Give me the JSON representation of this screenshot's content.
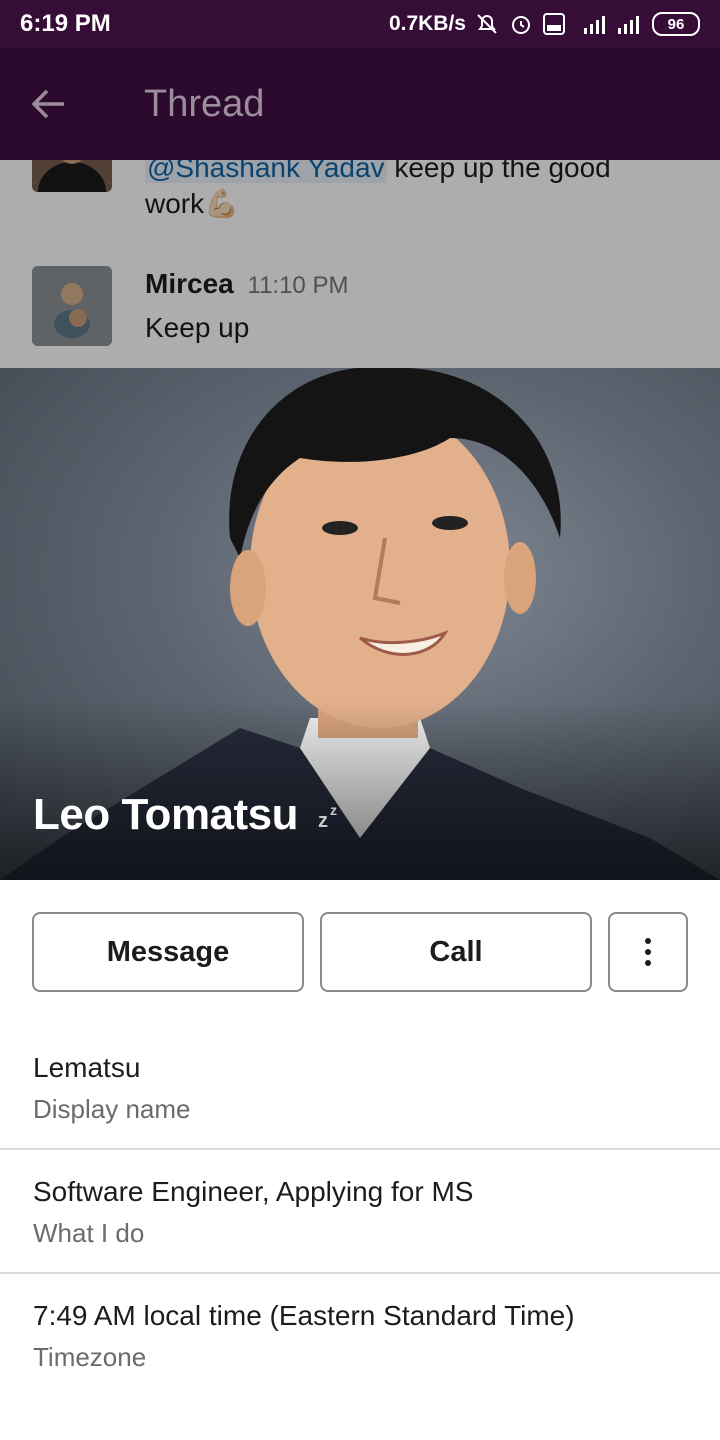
{
  "status_bar": {
    "time": "6:19 PM",
    "network_speed": "0.7KB/s",
    "battery": "96",
    "icons": [
      "mute-bell-icon",
      "alarm-icon",
      "volte-icon",
      "signal-4g-icon",
      "signal-icon",
      "battery-icon"
    ]
  },
  "app_bar": {
    "title": "Thread",
    "back_icon": "arrow-left-icon"
  },
  "thread": {
    "messages": [
      {
        "mention": "@Shashank Yadav",
        "text_after_mention": " keep up the good",
        "text_line2": "work",
        "emoji": "💪🏻"
      },
      {
        "author": "Mircea",
        "time": "11:10 PM",
        "text": "Keep up"
      }
    ]
  },
  "profile": {
    "name": "Leo Tomatsu",
    "status_icon": "sleep-zz-icon",
    "actions": {
      "message": "Message",
      "call": "Call",
      "more_icon": "more-vertical-icon"
    },
    "fields": [
      {
        "value": "Lematsu",
        "label": "Display name"
      },
      {
        "value": "Software Engineer, Applying for MS",
        "label": "What I do"
      },
      {
        "value": "7:49 AM local time (Eastern Standard Time)",
        "label": "Timezone"
      }
    ]
  },
  "colors": {
    "status_bar": "#350d36",
    "app_bar": "#2c0a2d",
    "mention": "#1264a3",
    "button_border": "#8a8a8a"
  }
}
